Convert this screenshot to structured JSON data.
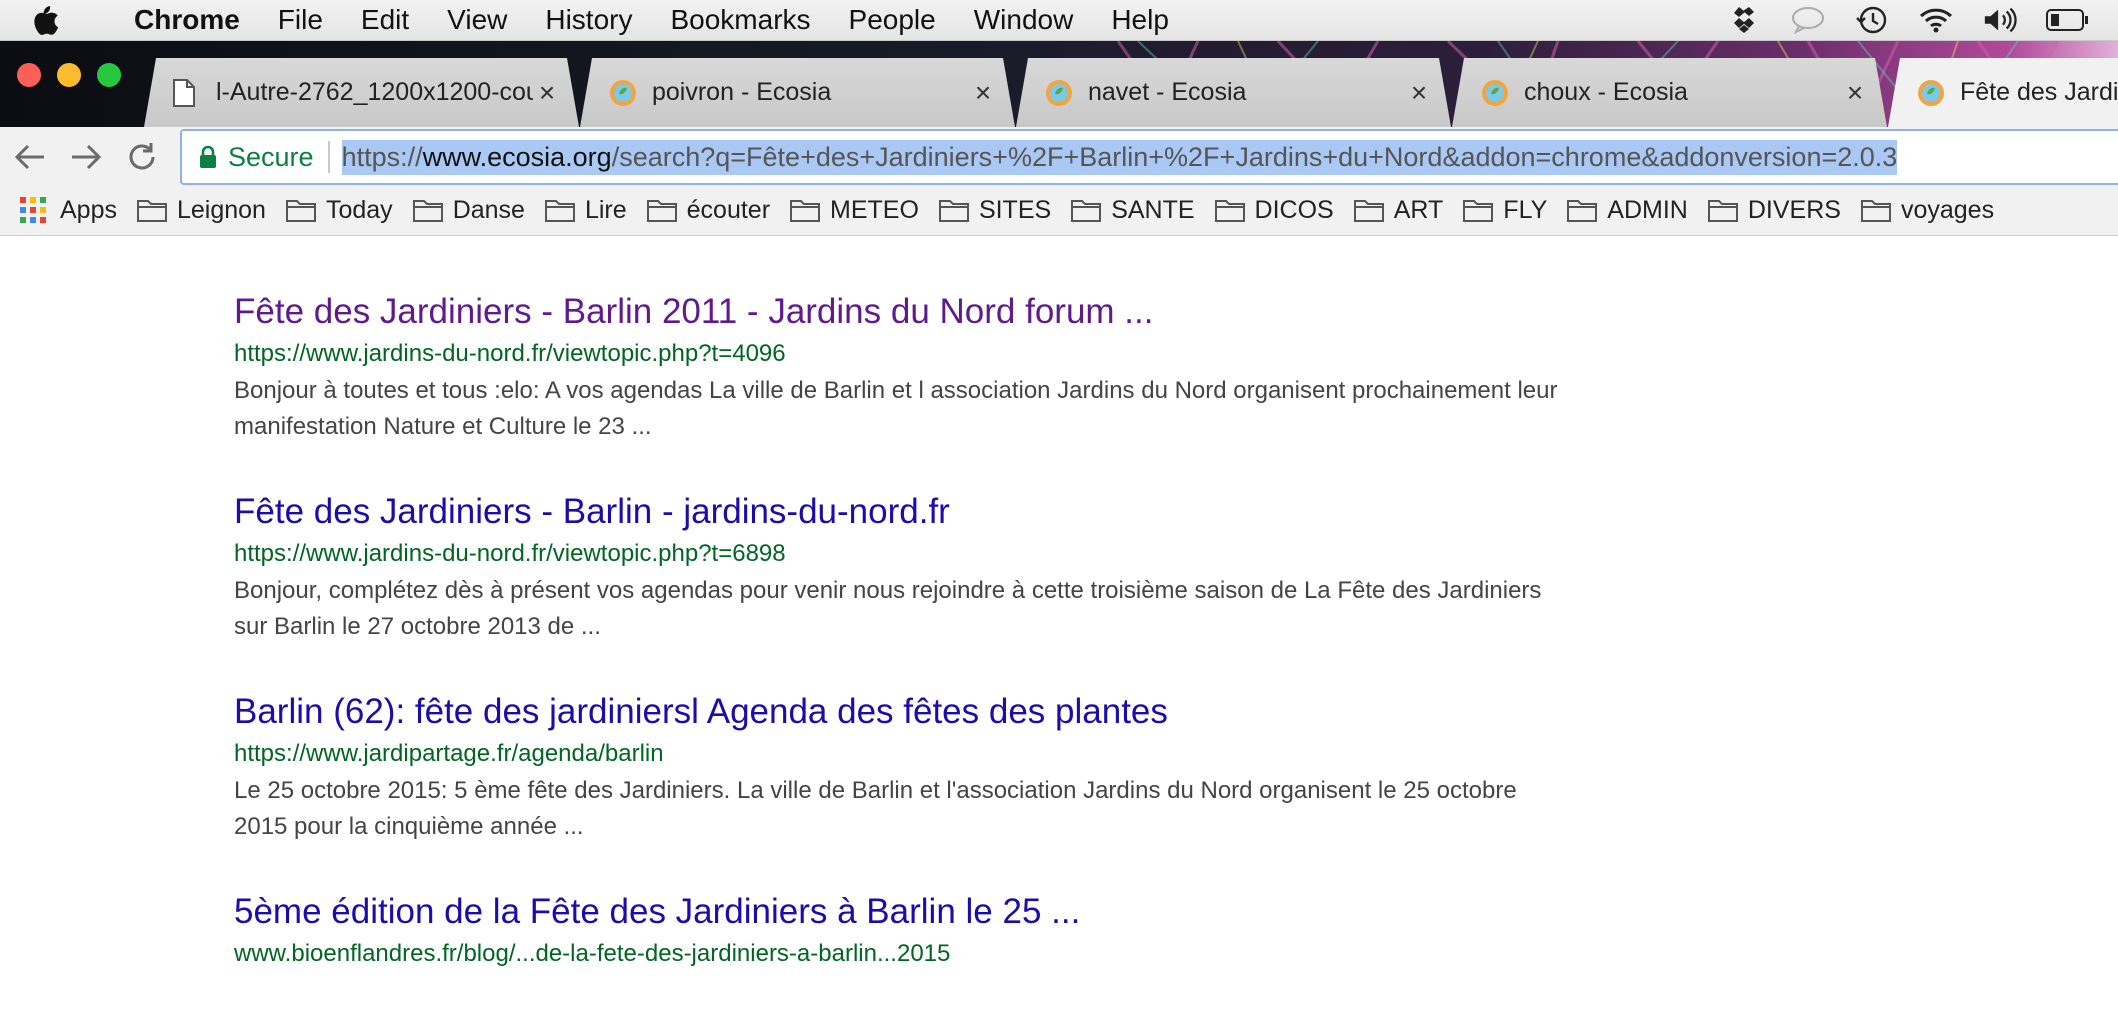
{
  "menubar": {
    "app_name": "Chrome",
    "items": [
      "File",
      "Edit",
      "View",
      "History",
      "Bookmarks",
      "People",
      "Window",
      "Help"
    ],
    "tray_icons": [
      "dropbox-icon",
      "speech-bubble-icon",
      "time-machine-icon",
      "wifi-icon",
      "volume-icon",
      "battery-icon"
    ]
  },
  "tabs": [
    {
      "title": "l-Autre-2762_1200x1200-cou",
      "icon": "page-icon"
    },
    {
      "title": "poivron - Ecosia",
      "icon": "ecosia-icon"
    },
    {
      "title": "navet - Ecosia",
      "icon": "ecosia-icon"
    },
    {
      "title": "choux - Ecosia",
      "icon": "ecosia-icon"
    },
    {
      "title": "Fête des Jardi",
      "icon": "ecosia-icon",
      "active": true
    }
  ],
  "tab_close_glyph": "×",
  "toolbar": {
    "secure_label": "Secure",
    "url_scheme": "https://",
    "url_host": "www.ecosia.org",
    "url_rest": "/search?q=Fête+des+Jardiniers+%2F+Barlin+%2F+Jardins+du+Nord&addon=chrome&addonversion=2.0.3"
  },
  "bookmarks": {
    "apps_label": "Apps",
    "folders": [
      "Leignon",
      "Today",
      "Danse",
      "Lire",
      "écouter",
      "METEO",
      "SITES",
      "SANTE",
      "DICOS",
      "ART",
      "FLY",
      "ADMIN",
      "DIVERS",
      "voyages"
    ]
  },
  "results": [
    {
      "title": "Fête des Jardiniers - Barlin 2011 - Jardins du Nord forum ...",
      "url": "https://www.jardins-du-nord.fr/viewtopic.php?t=4096",
      "snippet": "Bonjour à toutes et tous :elo: A vos agendas La ville de Barlin et l association Jardins du Nord organisent prochainement leur manifestation Nature et Culture le 23 ...",
      "visited": true
    },
    {
      "title": "Fête des Jardiniers - Barlin - jardins-du-nord.fr",
      "url": "https://www.jardins-du-nord.fr/viewtopic.php?t=6898",
      "snippet": "Bonjour, complétez dès à présent vos agendas pour venir nous rejoindre à cette troisième saison de La Fête des Jardiniers sur Barlin le 27 octobre 2013 de ...",
      "visited": false
    },
    {
      "title": "Barlin (62): fête des jardiniersl Agenda des fêtes des plantes",
      "url": "https://www.jardipartage.fr/agenda/barlin",
      "snippet": "Le 25 octobre 2015: 5 ème fête des Jardiniers. La ville de Barlin et l'association Jardins du Nord organisent le 25 octobre 2015 pour la cinquième année ...",
      "visited": false
    },
    {
      "title": "5ème édition de la Fête des Jardiniers à Barlin le 25 ...",
      "url": "www.bioenflandres.fr/blog/...de-la-fete-des-jardiniers-a-barlin...2015",
      "snippet": "",
      "visited": false
    }
  ]
}
